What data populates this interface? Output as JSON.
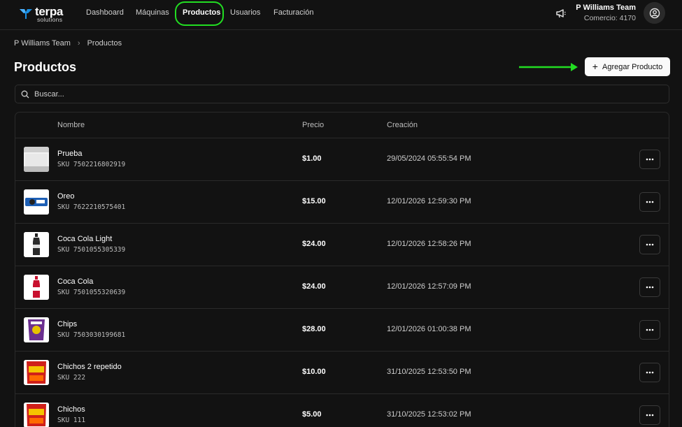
{
  "brand": {
    "name": "terpa",
    "sub": "solutions"
  },
  "nav": [
    {
      "label": "Dashboard"
    },
    {
      "label": "Máquinas"
    },
    {
      "label": "Productos",
      "active": true
    },
    {
      "label": "Usuarios"
    },
    {
      "label": "Facturación"
    }
  ],
  "user": {
    "name": "P Williams Team",
    "store": "Comercio: 4170"
  },
  "breadcrumb": [
    "P Williams Team",
    "Productos"
  ],
  "page_title": "Productos",
  "add_button": "Agregar Producto",
  "search": {
    "placeholder": "Buscar..."
  },
  "table": {
    "headers": {
      "name": "Nombre",
      "price": "Precio",
      "created": "Creación"
    },
    "rows": [
      {
        "name": "Prueba",
        "sku": "SKU 7502216802919",
        "price": "$1.00",
        "created": "29/05/2024 05:55:54 PM",
        "thumb": "screen"
      },
      {
        "name": "Oreo",
        "sku": "SKU 7622210575401",
        "price": "$15.00",
        "created": "12/01/2026 12:59:30 PM",
        "thumb": "oreo"
      },
      {
        "name": "Coca Cola Light",
        "sku": "SKU 7501055305339",
        "price": "$24.00",
        "created": "12/01/2026 12:58:26 PM",
        "thumb": "coke-light"
      },
      {
        "name": "Coca Cola",
        "sku": "SKU 7501055320639",
        "price": "$24.00",
        "created": "12/01/2026 12:57:09 PM",
        "thumb": "coke"
      },
      {
        "name": "Chips",
        "sku": "SKU 7503030199681",
        "price": "$28.00",
        "created": "12/01/2026 01:00:38 PM",
        "thumb": "chips"
      },
      {
        "name": "Chichos 2 repetido",
        "sku": "SKU 222",
        "price": "$10.00",
        "created": "31/10/2025 12:53:50 PM",
        "thumb": "cheetos"
      },
      {
        "name": "Chichos",
        "sku": "SKU 111",
        "price": "$5.00",
        "created": "31/10/2025 12:53:02 PM",
        "thumb": "cheetos"
      }
    ]
  },
  "colors": {
    "accent_highlight": "#22dd22",
    "background": "#121212",
    "brand_blue": "#1a8fe3"
  }
}
